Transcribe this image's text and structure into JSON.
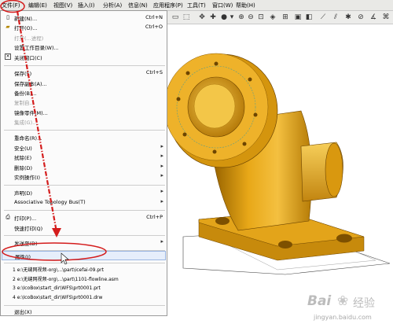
{
  "menubar": {
    "items": [
      "文件(F)",
      "编辑(E)",
      "视图(V)",
      "插入(I)",
      "分析(A)",
      "信息(N)",
      "应用程序(P)",
      "工具(T)",
      "窗口(W)",
      "帮助(H)"
    ]
  },
  "file_menu": {
    "items": [
      {
        "label": "新建(N)...",
        "shortcut": "Ctrl+N",
        "icon": "new-file-icon",
        "state": "normal"
      },
      {
        "label": "打开(O)...",
        "shortcut": "Ctrl+O",
        "icon": "open-folder-icon",
        "state": "normal"
      },
      {
        "label": "打开(...进程)",
        "shortcut": "",
        "icon": "",
        "state": "disabled"
      },
      {
        "label": "设置工作目录(W)...",
        "shortcut": "",
        "icon": "",
        "state": "normal"
      },
      {
        "label": "关闭窗口(C)",
        "shortcut": "",
        "icon": "close-window-icon",
        "state": "normal"
      },
      {
        "label": "保存(S)",
        "shortcut": "Ctrl+S",
        "icon": "",
        "state": "normal"
      },
      {
        "label": "保存副本(A)...",
        "shortcut": "",
        "icon": "",
        "state": "normal"
      },
      {
        "label": "备份(B)...",
        "shortcut": "",
        "icon": "",
        "state": "normal"
      },
      {
        "label": "复制自...",
        "shortcut": "",
        "icon": "",
        "state": "disabled"
      },
      {
        "label": "镜像零件(M)...",
        "shortcut": "",
        "icon": "",
        "state": "normal"
      },
      {
        "label": "集成(G)...",
        "shortcut": "",
        "icon": "",
        "state": "disabled"
      },
      {
        "label": "重命名(R)...",
        "shortcut": "",
        "icon": "",
        "state": "normal"
      },
      {
        "label": "安全(U)",
        "shortcut": "",
        "icon": "",
        "state": "normal",
        "submenu": true
      },
      {
        "label": "拭除(E)",
        "shortcut": "",
        "icon": "",
        "state": "normal",
        "submenu": true
      },
      {
        "label": "删除(D)",
        "shortcut": "",
        "icon": "",
        "state": "normal",
        "submenu": true
      },
      {
        "label": "实例操作(I)",
        "shortcut": "",
        "icon": "",
        "state": "normal",
        "submenu": true
      },
      {
        "label": "声明(D)",
        "shortcut": "",
        "icon": "",
        "state": "normal",
        "submenu": true
      },
      {
        "label": "Associative Topology Bus(T)",
        "shortcut": "",
        "icon": "",
        "state": "normal",
        "submenu": true
      },
      {
        "label": "打印(P)...",
        "shortcut": "Ctrl+P",
        "icon": "print-icon",
        "state": "normal"
      },
      {
        "label": "快速打印(Q)",
        "shortcut": "",
        "icon": "",
        "state": "normal"
      },
      {
        "label": "发送至(D)",
        "shortcut": "",
        "icon": "",
        "state": "normal",
        "submenu": true
      },
      {
        "label": "属性(I)",
        "shortcut": "",
        "icon": "",
        "state": "highlighted"
      },
      {
        "label": "1 e:\\无缝网视频-org\\...\\part\\icefai-09.prt",
        "shortcut": "",
        "icon": "",
        "state": "normal"
      },
      {
        "label": "2 e:\\无缝网视频-org\\...\\part\\1101-flowline.asm",
        "shortcut": "",
        "icon": "",
        "state": "normal"
      },
      {
        "label": "3 e:\\IcoBox\\start_dir\\WFS\\prt0001.prt",
        "shortcut": "",
        "icon": "",
        "state": "normal"
      },
      {
        "label": "4 e:\\IcoBox\\start_dir\\WFS\\prt0001.drw",
        "shortcut": "",
        "icon": "",
        "state": "normal"
      },
      {
        "label": "退出(X)",
        "shortcut": "",
        "icon": "",
        "state": "normal"
      }
    ]
  },
  "toolbar_icons": [
    "frame-icon",
    "select-icon",
    "spin-center-icon",
    "shading-icon",
    "dropdown-icon",
    "zoom-in-icon",
    "zoom-out-icon",
    "refit-icon",
    "repaint-icon",
    "orient-icon",
    "saved-views-icon",
    "layers-icon",
    "datum-plane-icon",
    "datum-axis-icon",
    "datum-point-icon",
    "csys-icon"
  ],
  "watermark": {
    "brand": "Bai",
    "brand2": "经验",
    "url": "jingyan.baidu.com"
  },
  "colors": {
    "model_main": "#e1a116",
    "model_dark": "#8a5a00",
    "model_light": "#f7d060",
    "annotation": "#d41c1c",
    "menu_highlight": "#e6eefb"
  }
}
